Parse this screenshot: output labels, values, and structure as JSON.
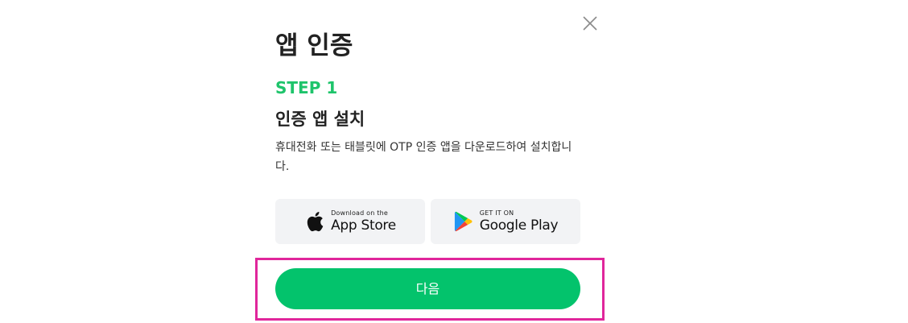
{
  "modal": {
    "title": "앱 인증",
    "close_icon": "close-icon"
  },
  "step": {
    "label": "STEP 1",
    "title": "인증 앱 설치",
    "description": "휴대전화 또는 태블릿에 OTP 인증 앱을 다운로드하여 설치합니다."
  },
  "stores": {
    "app_store": {
      "small": "Download on the",
      "big": "App Store",
      "icon": "apple-icon"
    },
    "google_play": {
      "small": "GET IT ON",
      "big": "Google Play",
      "icon": "google-play-icon"
    }
  },
  "actions": {
    "next_label": "다음"
  },
  "colors": {
    "accent_green": "#03c36c",
    "step_green": "#1ec46b",
    "highlight_pink": "#e0269b",
    "store_bg": "#f2f3f5"
  }
}
